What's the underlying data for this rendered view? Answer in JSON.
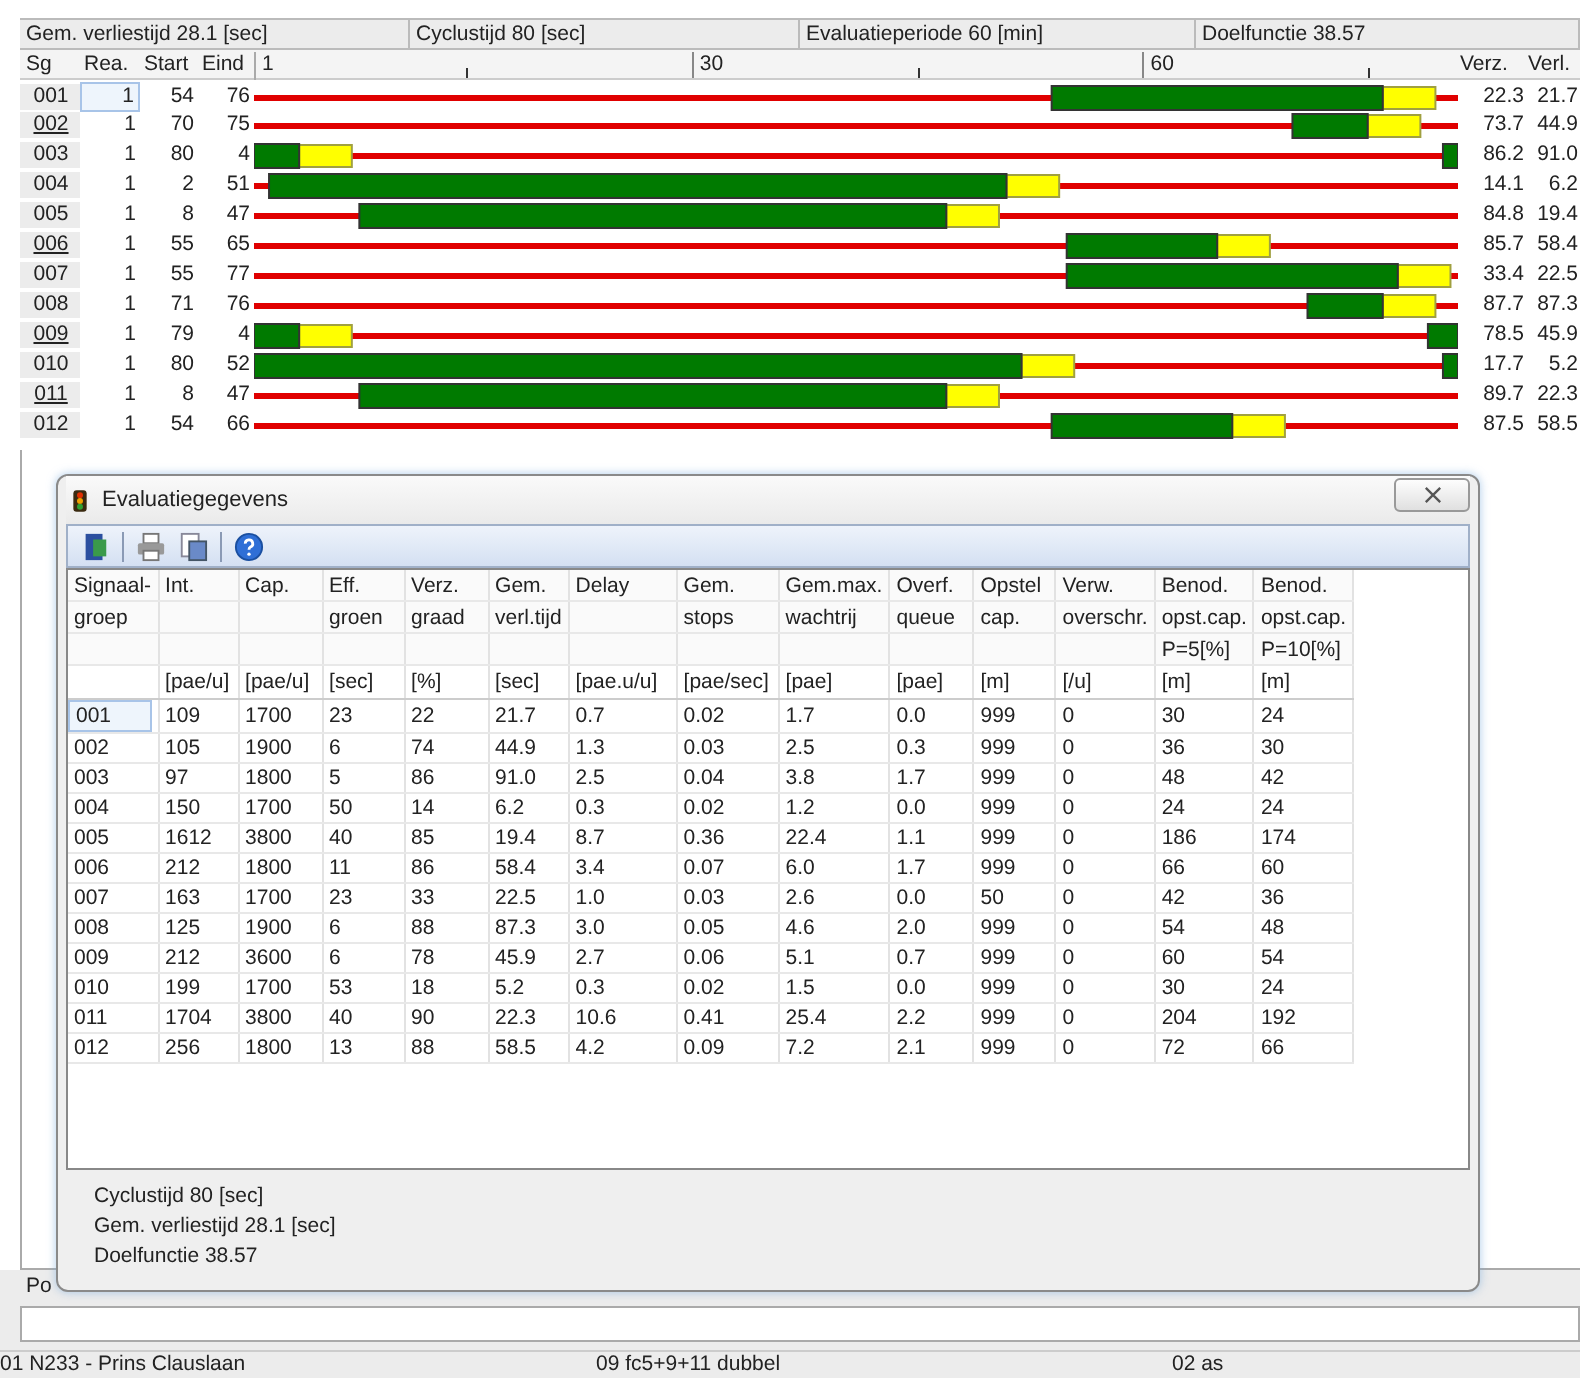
{
  "top_bar": [
    "Gem. verliestijd 28.1 [sec]",
    "Cyclustijd 80 [sec]",
    "Evaluatieperiode 60 [min]",
    "Doelfunctie 38.57"
  ],
  "grid": {
    "columns": [
      "Sg",
      "Rea.",
      "Start",
      "Eind"
    ],
    "ticks": [
      "1",
      "30",
      "60"
    ],
    "right_columns": [
      "Verz.",
      "Verl."
    ],
    "rows": [
      {
        "sg": "001",
        "underlined": false,
        "focused": true,
        "rea": "1",
        "start": "54",
        "end": "76",
        "verz": "22.3",
        "verl": "21.7"
      },
      {
        "sg": "002",
        "underlined": true,
        "focused": false,
        "rea": "1",
        "start": "70",
        "end": "75",
        "verz": "73.7",
        "verl": "44.9"
      },
      {
        "sg": "003",
        "underlined": false,
        "focused": false,
        "rea": "1",
        "start": "80",
        "end": "4",
        "verz": "86.2",
        "verl": "91.0"
      },
      {
        "sg": "004",
        "underlined": false,
        "focused": false,
        "rea": "1",
        "start": "2",
        "end": "51",
        "verz": "14.1",
        "verl": "6.2"
      },
      {
        "sg": "005",
        "underlined": false,
        "focused": false,
        "rea": "1",
        "start": "8",
        "end": "47",
        "verz": "84.8",
        "verl": "19.4"
      },
      {
        "sg": "006",
        "underlined": true,
        "focused": false,
        "rea": "1",
        "start": "55",
        "end": "65",
        "verz": "85.7",
        "verl": "58.4"
      },
      {
        "sg": "007",
        "underlined": false,
        "focused": false,
        "rea": "1",
        "start": "55",
        "end": "77",
        "verz": "33.4",
        "verl": "22.5"
      },
      {
        "sg": "008",
        "underlined": false,
        "focused": false,
        "rea": "1",
        "start": "71",
        "end": "76",
        "verz": "87.7",
        "verl": "87.3"
      },
      {
        "sg": "009",
        "underlined": true,
        "focused": false,
        "rea": "1",
        "start": "79",
        "end": "4",
        "verz": "78.5",
        "verl": "45.9"
      },
      {
        "sg": "010",
        "underlined": false,
        "focused": false,
        "rea": "1",
        "start": "80",
        "end": "52",
        "verz": "17.7",
        "verl": "5.2"
      },
      {
        "sg": "011",
        "underlined": true,
        "focused": false,
        "rea": "1",
        "start": "8",
        "end": "47",
        "verz": "89.7",
        "verl": "22.3"
      },
      {
        "sg": "012",
        "underlined": false,
        "focused": false,
        "rea": "1",
        "start": "54",
        "end": "66",
        "verz": "87.5",
        "verl": "58.5"
      }
    ]
  },
  "panel_label": "Po",
  "status_bar": [
    "01 N233 - Prins Clauslaan",
    "09 fc5+9+11 dubbel",
    "02 as"
  ],
  "dialog": {
    "title": "Evaluatiegegevens",
    "columns": [
      {
        "label": [
          "Signaal-",
          "groep"
        ]
      },
      {
        "label": [
          "Int."
        ],
        "unit": "[pae/u]"
      },
      {
        "label": [
          "Cap."
        ],
        "unit": "[pae/u]"
      },
      {
        "label": [
          "Eff.",
          "groen"
        ],
        "unit": "[sec]"
      },
      {
        "label": [
          "Verz.",
          "graad"
        ],
        "unit": "[%]"
      },
      {
        "label": [
          "Gem.",
          "verl.tijd"
        ],
        "unit": "[sec]"
      },
      {
        "label": [
          "Delay"
        ],
        "unit": "[pae.u/u]"
      },
      {
        "label": [
          "Gem.",
          "stops"
        ],
        "unit": "[pae/sec]"
      },
      {
        "label": [
          "Gem.max.",
          "wachtrij"
        ],
        "unit": "[pae]"
      },
      {
        "label": [
          "Overf.",
          "queue"
        ],
        "unit": "[pae]"
      },
      {
        "label": [
          "Opstel",
          "cap."
        ],
        "unit": "[m]"
      },
      {
        "label": [
          "Verw.",
          "overschr."
        ],
        "unit": "[/u]"
      },
      {
        "label": [
          "Benod.",
          "opst.cap.",
          "P=5[%]"
        ],
        "unit": "[m]"
      },
      {
        "label": [
          "Benod.",
          "opst.cap.",
          "P=10[%]"
        ],
        "unit": "[m]"
      }
    ],
    "rows": [
      {
        "focused": true,
        "cells": [
          "001",
          "109",
          "1700",
          "23",
          "22",
          "21.7",
          "0.7",
          "0.02",
          "1.7",
          "0.0",
          "999",
          "0",
          "30",
          "24"
        ]
      },
      {
        "focused": false,
        "cells": [
          "002",
          "105",
          "1900",
          "6",
          "74",
          "44.9",
          "1.3",
          "0.03",
          "2.5",
          "0.3",
          "999",
          "0",
          "36",
          "30"
        ]
      },
      {
        "focused": false,
        "cells": [
          "003",
          "97",
          "1800",
          "5",
          "86",
          "91.0",
          "2.5",
          "0.04",
          "3.8",
          "1.7",
          "999",
          "0",
          "48",
          "42"
        ]
      },
      {
        "focused": false,
        "cells": [
          "004",
          "150",
          "1700",
          "50",
          "14",
          "6.2",
          "0.3",
          "0.02",
          "1.2",
          "0.0",
          "999",
          "0",
          "24",
          "24"
        ]
      },
      {
        "focused": false,
        "cells": [
          "005",
          "1612",
          "3800",
          "40",
          "85",
          "19.4",
          "8.7",
          "0.36",
          "22.4",
          "1.1",
          "999",
          "0",
          "186",
          "174"
        ]
      },
      {
        "focused": false,
        "cells": [
          "006",
          "212",
          "1800",
          "11",
          "86",
          "58.4",
          "3.4",
          "0.07",
          "6.0",
          "1.7",
          "999",
          "0",
          "66",
          "60"
        ]
      },
      {
        "focused": false,
        "cells": [
          "007",
          "163",
          "1700",
          "23",
          "33",
          "22.5",
          "1.0",
          "0.03",
          "2.6",
          "0.0",
          "50",
          "0",
          "42",
          "36"
        ]
      },
      {
        "focused": false,
        "cells": [
          "008",
          "125",
          "1900",
          "6",
          "88",
          "87.3",
          "3.0",
          "0.05",
          "4.6",
          "2.0",
          "999",
          "0",
          "54",
          "48"
        ]
      },
      {
        "focused": false,
        "cells": [
          "009",
          "212",
          "3600",
          "6",
          "78",
          "45.9",
          "2.7",
          "0.06",
          "5.1",
          "0.7",
          "999",
          "0",
          "60",
          "54"
        ]
      },
      {
        "focused": false,
        "cells": [
          "010",
          "199",
          "1700",
          "53",
          "18",
          "5.2",
          "0.3",
          "0.02",
          "1.5",
          "0.0",
          "999",
          "0",
          "30",
          "24"
        ]
      },
      {
        "focused": false,
        "cells": [
          "011",
          "1704",
          "3800",
          "40",
          "90",
          "22.3",
          "10.6",
          "0.41",
          "25.4",
          "2.2",
          "999",
          "0",
          "204",
          "192"
        ]
      },
      {
        "focused": false,
        "cells": [
          "012",
          "256",
          "1800",
          "13",
          "88",
          "58.5",
          "4.2",
          "0.09",
          "7.2",
          "2.1",
          "999",
          "0",
          "72",
          "66"
        ]
      }
    ],
    "summary": [
      "Cyclustijd 80 [sec]",
      "Gem. verliestijd 28.1 [sec]",
      "Doelfunctie 38.57"
    ]
  }
}
